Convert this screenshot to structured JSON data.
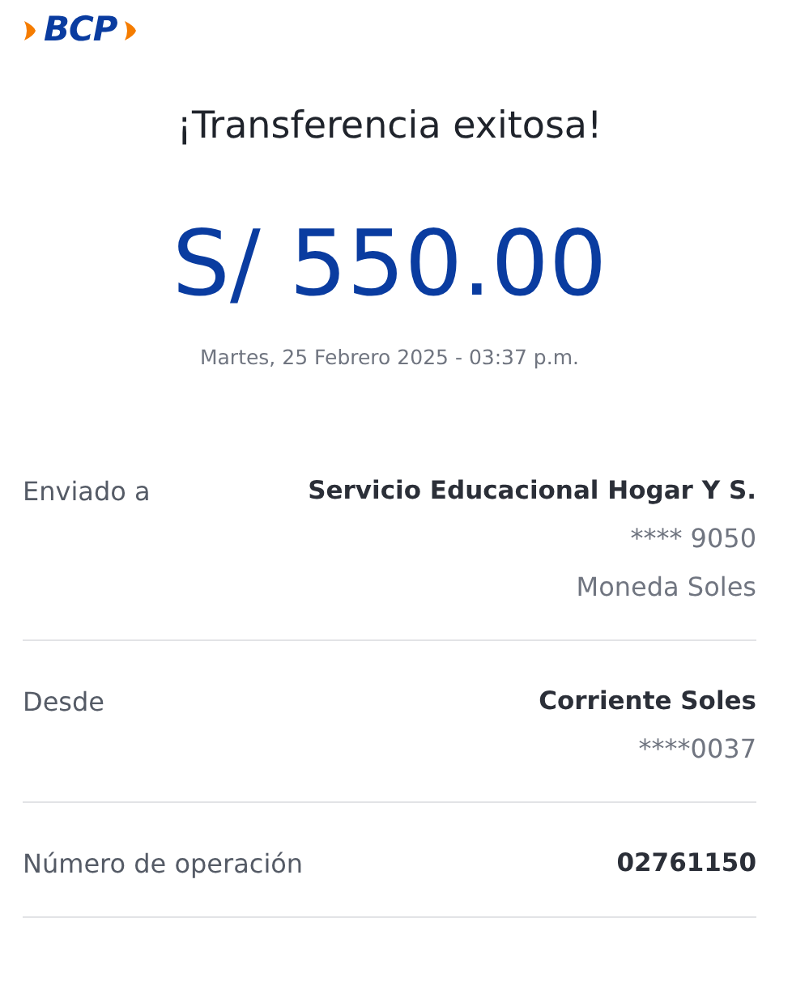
{
  "logo": {
    "text": "BCP"
  },
  "title": "¡Transferencia exitosa!",
  "amount": "S/ 550.00",
  "datetime": "Martes, 25 Febrero 2025 - 03:37 p.m.",
  "details": [
    {
      "label": "Enviado a",
      "values": [
        "Servicio Educacional Hogar Y S.",
        "**** 9050",
        "Moneda Soles"
      ]
    },
    {
      "label": "Desde",
      "values": [
        "Corriente Soles",
        "****0037"
      ]
    },
    {
      "label": "Número de operación",
      "values": [
        "02761150"
      ]
    }
  ]
}
